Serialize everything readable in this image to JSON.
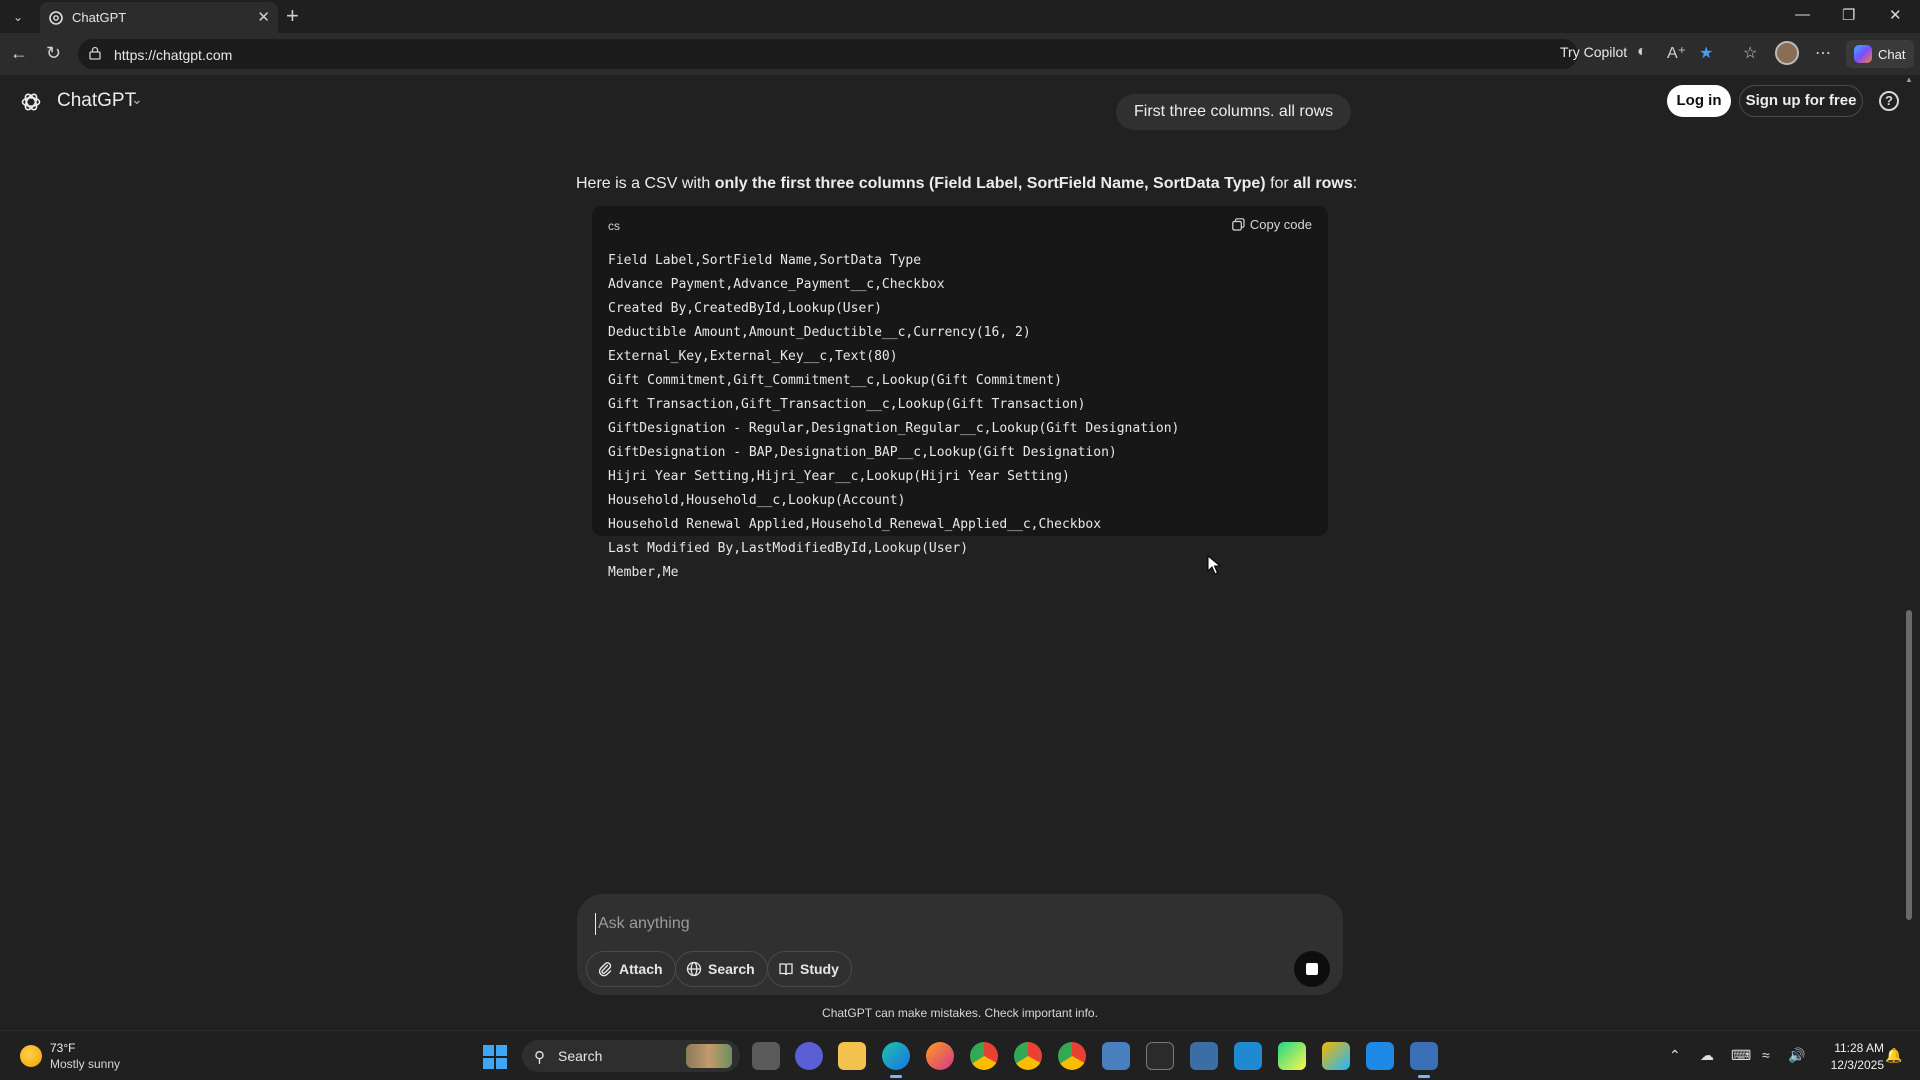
{
  "browser": {
    "tab_title": "ChatGPT",
    "url": "https://chatgpt.com",
    "try_copilot": "Try Copilot",
    "chat_button": "Chat"
  },
  "header": {
    "app_title": "ChatGPT",
    "login": "Log in",
    "signup": "Sign up for free",
    "help": "?"
  },
  "conversation": {
    "user_message": "First three columns. all rows",
    "reply_parts": [
      {
        "text": "Here is a CSV with ",
        "bold": false
      },
      {
        "text": "only the first three columns (Field Label, SortField Name, SortData Type)",
        "bold": true
      },
      {
        "text": " for ",
        "bold": false
      },
      {
        "text": "all rows",
        "bold": true
      },
      {
        "text": ":",
        "bold": false
      }
    ],
    "code": {
      "language": "cs",
      "copy_label": "Copy code",
      "lines": [
        "Field Label,SortField Name,SortData Type",
        "Advance Payment,Advance_Payment__c,Checkbox",
        "Created By,CreatedById,Lookup(User)",
        "Deductible Amount,Amount_Deductible__c,Currency(16, 2)",
        "External_Key,External_Key__c,Text(80)",
        "Gift Commitment,Gift_Commitment__c,Lookup(Gift Commitment)",
        "Gift Transaction,Gift_Transaction__c,Lookup(Gift Transaction)",
        "GiftDesignation - Regular,Designation_Regular__c,Lookup(Gift Designation)",
        "GiftDesignation - BAP,Designation_BAP__c,Lookup(Gift Designation)",
        "Hijri Year Setting,Hijri_Year__c,Lookup(Hijri Year Setting)",
        "Household,Household__c,Lookup(Account)",
        "Household Renewal Applied,Household_Renewal_Applied__c,Checkbox",
        "Last Modified By,LastModifiedById,Lookup(User)",
        "Member,Me"
      ]
    }
  },
  "composer": {
    "placeholder": "Ask anything",
    "attach": "Attach",
    "search": "Search",
    "study": "Study",
    "disclaimer": "ChatGPT can make mistakes. Check important info."
  },
  "taskbar": {
    "weather_temp": "73°F",
    "weather_desc": "Mostly sunny",
    "search_label": "Search",
    "time": "11:28 AM",
    "date": "12/3/2025"
  },
  "colors": {
    "page_bg": "#212121",
    "code_bg": "#171717",
    "bubble_bg": "#303030",
    "accent_blue": "#3fa5f5"
  }
}
